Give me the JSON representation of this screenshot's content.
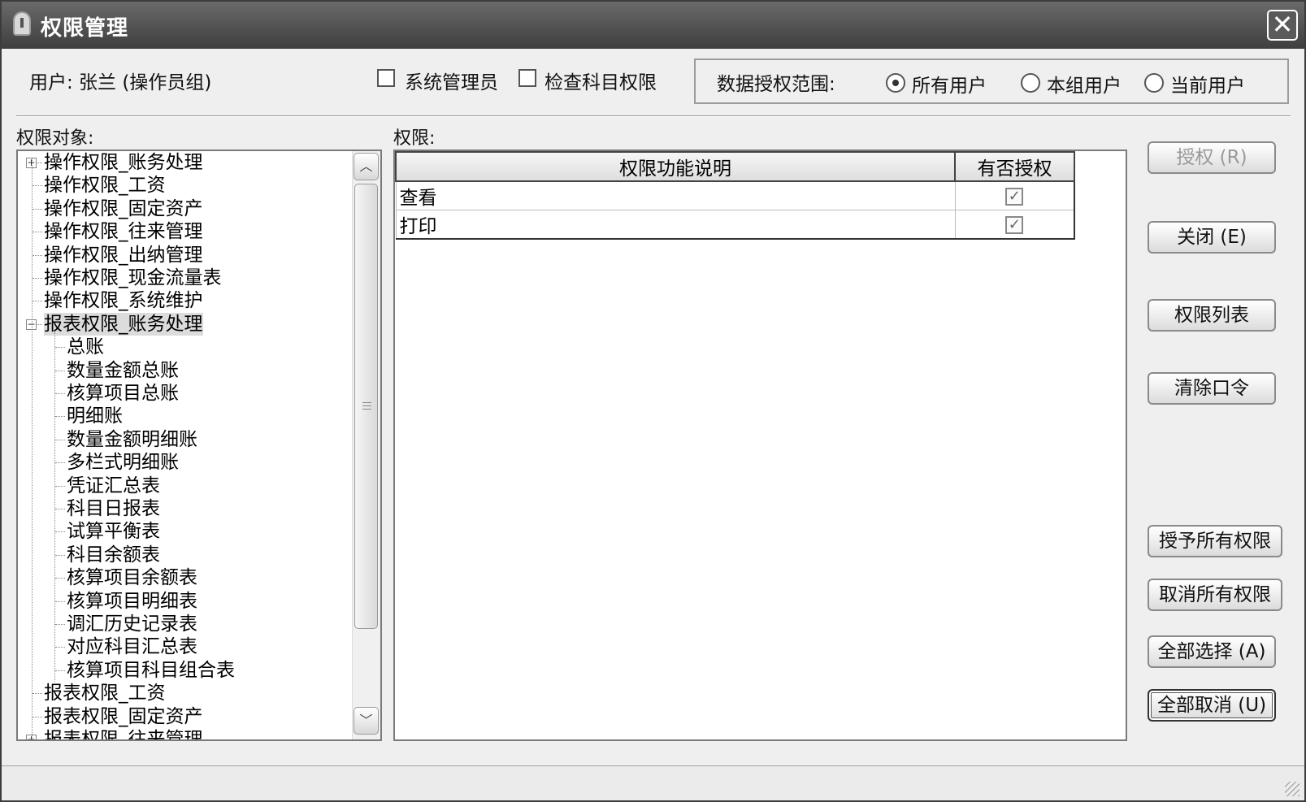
{
  "window": {
    "title": "权限管理",
    "close_glyph": "✕"
  },
  "header": {
    "user_label": "用户: 张兰 (操作员组)",
    "checkbox_admin": {
      "label": "系统管理员",
      "checked": false
    },
    "checkbox_subject": {
      "label": "检查科目权限",
      "checked": false
    },
    "scope_label": "数据授权范围:",
    "scope_options": [
      {
        "label": "所有用户",
        "selected": true
      },
      {
        "label": "本组用户",
        "selected": false
      },
      {
        "label": "当前用户",
        "selected": false
      }
    ]
  },
  "tree": {
    "label": "权限对象:",
    "items": [
      {
        "text": "操作权限_账务处理",
        "level": 0,
        "expander": "+"
      },
      {
        "text": "操作权限_工资",
        "level": 0
      },
      {
        "text": "操作权限_固定资产",
        "level": 0
      },
      {
        "text": "操作权限_往来管理",
        "level": 0
      },
      {
        "text": "操作权限_出纳管理",
        "level": 0
      },
      {
        "text": "操作权限_现金流量表",
        "level": 0
      },
      {
        "text": "操作权限_系统维护",
        "level": 0
      },
      {
        "text": "报表权限_账务处理",
        "level": 0,
        "expander": "−",
        "selected": true
      },
      {
        "text": "总账",
        "level": 1
      },
      {
        "text": "数量金额总账",
        "level": 1
      },
      {
        "text": "核算项目总账",
        "level": 1
      },
      {
        "text": "明细账",
        "level": 1
      },
      {
        "text": "数量金额明细账",
        "level": 1
      },
      {
        "text": "多栏式明细账",
        "level": 1
      },
      {
        "text": "凭证汇总表",
        "level": 1
      },
      {
        "text": "科目日报表",
        "level": 1
      },
      {
        "text": "试算平衡表",
        "level": 1
      },
      {
        "text": "科目余额表",
        "level": 1
      },
      {
        "text": "核算项目余额表",
        "level": 1
      },
      {
        "text": "核算项目明细表",
        "level": 1
      },
      {
        "text": "调汇历史记录表",
        "level": 1
      },
      {
        "text": "对应科目汇总表",
        "level": 1
      },
      {
        "text": "核算项目科目组合表",
        "level": 1
      },
      {
        "text": "报表权限_工资",
        "level": 0
      },
      {
        "text": "报表权限_固定资产",
        "level": 0
      },
      {
        "text": "报表权限_往来管理",
        "level": 0,
        "expander": "+"
      }
    ],
    "scroll_up_glyph": "︿",
    "scroll_down_glyph": "﹀"
  },
  "permissions": {
    "label": "权限:",
    "columns": [
      "权限功能说明",
      "有否授权"
    ],
    "rows": [
      {
        "name": "查看",
        "granted": true
      },
      {
        "name": "打印",
        "granted": true
      }
    ],
    "check_glyph": "✓"
  },
  "buttons": {
    "grant": "授权 (R)",
    "close": "关闭 (E)",
    "list": "权限列表",
    "clear_password": "清除口令",
    "grant_all": "授予所有权限",
    "revoke_all": "取消所有权限",
    "select_all": "全部选择 (A)",
    "deselect_all": "全部取消 (U)"
  }
}
